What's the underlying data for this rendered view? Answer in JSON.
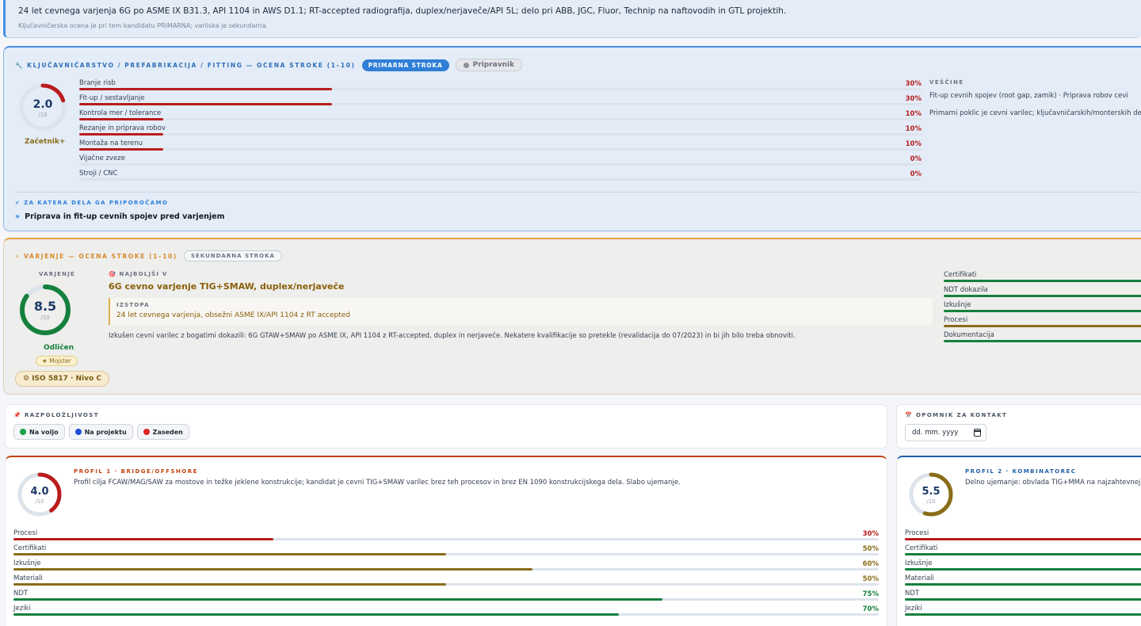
{
  "summary": {
    "text": "24 let cevnega varjenja 6G po ASME IX B31.3, API 1104 in AWS D1.1; RT-accepted radiografija, duplex/nerjaveče/API 5L; delo pri ABB, JGC, Fluor, Technip na naftovodih in GTL projektih.",
    "note": "Ključavničarska ocena je pri tem kandidatu PRIMARNA; varilska je sekundarna."
  },
  "primary": {
    "title": "🔧 KLJUČAVNIČARSTVO / PREFABRIKACIJA / FITTING — OCENA STROKE (1–10)",
    "badge": "PRIMARNA STROKA",
    "level_badge": "Pripravnik",
    "score": "2.0",
    "score_value": 2.0,
    "unit": "/10",
    "grade": "Začetnik+",
    "bars": [
      {
        "label": "Branje risb",
        "pct": "30%",
        "value": 30
      },
      {
        "label": "Fit-up / sestavljanje",
        "pct": "30%",
        "value": 30
      },
      {
        "label": "Kontrola mer / tolerance",
        "pct": "10%",
        "value": 10
      },
      {
        "label": "Rezanje in priprava robov",
        "pct": "10%",
        "value": 10
      },
      {
        "label": "Montaža na terenu",
        "pct": "10%",
        "value": 10
      },
      {
        "label": "Vijačne zveze",
        "pct": "0%",
        "value": 0
      },
      {
        "label": "Stroji / CNC",
        "pct": "0%",
        "value": 0
      }
    ],
    "skills_label": "VEŠČINE",
    "skills_line1": "Fit-up cevnih spojev (root gap, zamik) · Priprava robov cevi",
    "skills_line2": "Primarni poklic je cevni varilec; ključavničarskih/monterskih del",
    "recommend_label": "✔ ZA KATERA DELA GA PRIPOROČAMO",
    "recommend_bullet": "»",
    "recommend_item": "Priprava in fit-up cevnih spojev pred varjenjem"
  },
  "secondary": {
    "title": "⚡ VARJENJE — OCENA STROKE (1–10)",
    "badge": "SEKUNDARNA STROKA",
    "gauge_label": "VARJENJE",
    "score": "8.5",
    "score_value": 8.5,
    "unit": "/10",
    "grade": "Odličen",
    "rank": "★ Mojster",
    "iso": "⚙ ISO 5817 · Nivo C",
    "best_label": "🎯 NAJBOLJŠI V",
    "best_title": "6G cevno varjenje TIG+SMAW, duplex/nerjaveče",
    "standout_label": "IZSTOPA",
    "standout_text": "24 let cevnega varjenja, obsežni ASME IX/API 1104 z RT accepted",
    "description": "Izkušen cevni varilec z bogatimi dokazili: 6G GTAW+SMAW po ASME IX, API 1104 z RT-accepted, duplex in nerjaveče. Nekatere kvalifikacije so pretekle (revalidacija do 07/2023) in bi jih bilo treba obnoviti.",
    "side_bars": [
      {
        "label": "Certifikati",
        "color": "#15803d"
      },
      {
        "label": "NDT dokazila",
        "color": "#15803d"
      },
      {
        "label": "Izkušnje",
        "color": "#15803d"
      },
      {
        "label": "Procesi",
        "color": "#8a6d1a"
      },
      {
        "label": "Dokumentacija",
        "color": "#15803d"
      }
    ]
  },
  "availability": {
    "label": "📌 RAZPOLOŽLJIVOST",
    "options": [
      {
        "label": "Na voljo",
        "color": "#16a34a"
      },
      {
        "label": "Na projektu",
        "color": "#1d4ed8"
      },
      {
        "label": "Zaseden",
        "color": "#dc2626"
      }
    ]
  },
  "contact": {
    "label": "📅 OPOMNIK ZA KONTAKT",
    "date_placeholder": "dd. mm. yyyy"
  },
  "profiles": [
    {
      "title": "PROFIL 1 · BRIDGE/OFFSHORE",
      "score": "4.0",
      "score_value": 4.0,
      "unit": "/10",
      "ring_color": "#b91c1c",
      "description": "Profil cilja FCAW/MAG/SAW za mostove in težke jeklene konstrukcije; kandidat je cevni TIG+SMAW varilec brez teh procesov in brez EN 1090 konstrukcijskega dela. Slabo ujemanje.",
      "bars": [
        {
          "label": "Procesi",
          "pct": "30%",
          "value": 30,
          "color": "#b91c1c"
        },
        {
          "label": "Certifikati",
          "pct": "50%",
          "value": 50,
          "color": "#8a6d1a"
        },
        {
          "label": "Izkušnje",
          "pct": "60%",
          "value": 60,
          "color": "#8a6d1a"
        },
        {
          "label": "Materiali",
          "pct": "50%",
          "value": 50,
          "color": "#8a6d1a"
        },
        {
          "label": "NDT",
          "pct": "75%",
          "value": 75,
          "color": "#15803d"
        },
        {
          "label": "Jeziki",
          "pct": "70%",
          "value": 70,
          "color": "#15803d"
        }
      ]
    },
    {
      "title": "PROFIL 2 · KOMBINATOREC",
      "score": "5.5",
      "score_value": 5.5,
      "unit": "/10",
      "ring_color": "#8a6d1a",
      "description": "Delno ujemanje: obvlada TIG+MMA na najzahtevnejši",
      "bars": [
        {
          "label": "Procesi",
          "color": "#b91c1c"
        },
        {
          "label": "Certifikati",
          "color": "#15803d"
        },
        {
          "label": "Izkušnje",
          "color": "#15803d"
        },
        {
          "label": "Materiali",
          "color": "#15803d"
        },
        {
          "label": "NDT",
          "color": "#15803d"
        },
        {
          "label": "Jeziki",
          "color": "#15803d"
        }
      ]
    }
  ]
}
